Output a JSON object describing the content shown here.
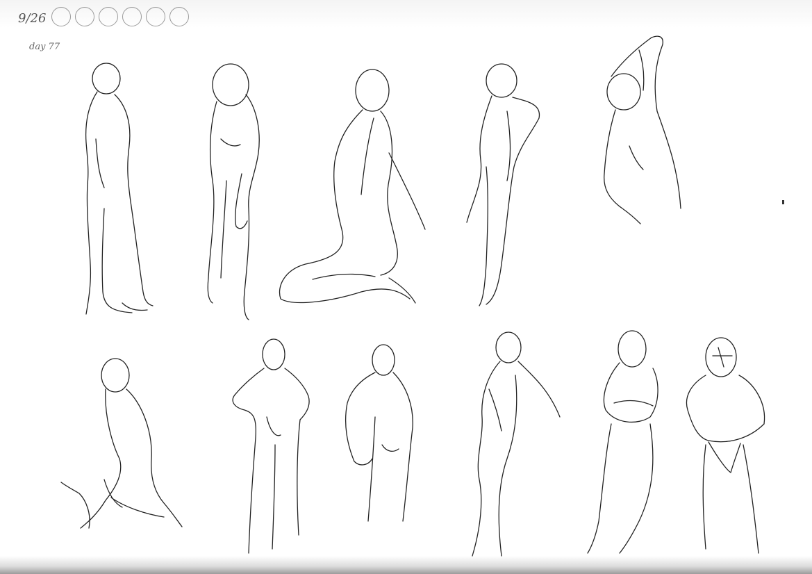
{
  "sheet": {
    "date": "9/26",
    "day_label": "day 77",
    "progress_circles": 6,
    "ink_color": "#222222",
    "paper_color": "#ffffff"
  },
  "icons": [
    "progress-circle-icon"
  ]
}
